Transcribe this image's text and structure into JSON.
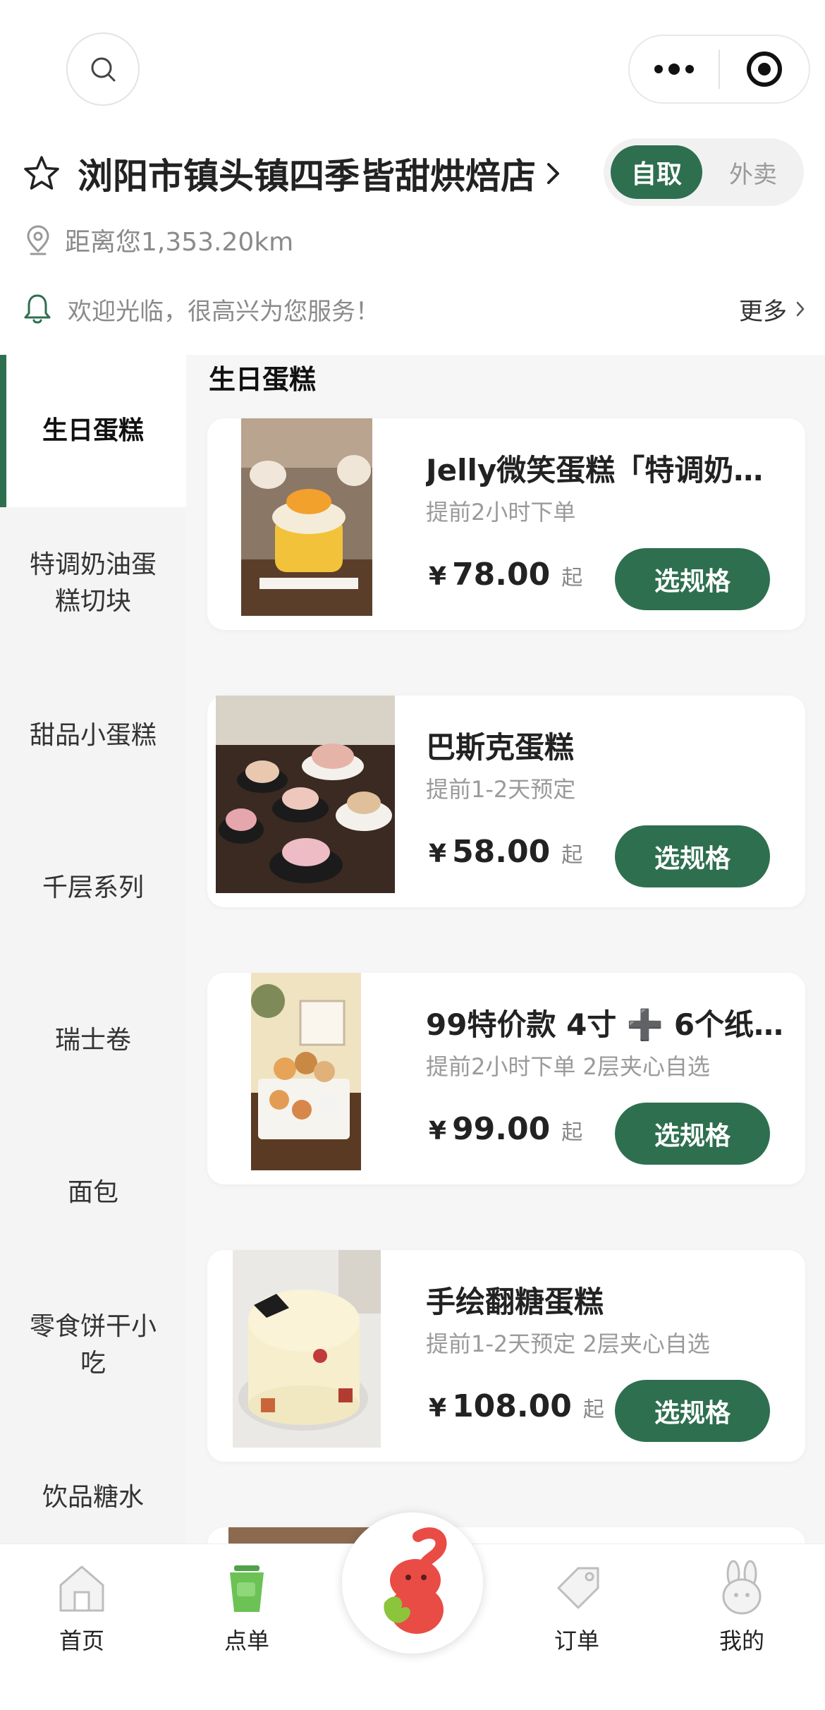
{
  "header": {
    "store_name": "浏阳市镇头镇四季皆甜烘焙店",
    "mode_active": "自取",
    "mode_inactive": "外卖",
    "distance": "距离您1,353.20km",
    "notice": "欢迎光临，很高兴为您服务！",
    "more": "更多"
  },
  "colors": {
    "accent": "#2e6f4f",
    "background": "#f6f6f6"
  },
  "sidebar": {
    "items": [
      {
        "label": "生日蛋糕",
        "active": true
      },
      {
        "label": "特调奶油蛋糕切块"
      },
      {
        "label": "甜品小蛋糕"
      },
      {
        "label": "千层系列"
      },
      {
        "label": "瑞士卷"
      },
      {
        "label": "面包"
      },
      {
        "label": "零食饼干小吃"
      },
      {
        "label": "饮品糖水"
      }
    ]
  },
  "section": {
    "title": "生日蛋糕"
  },
  "products": [
    {
      "name": "Jelly微笑蛋糕「特调奶…",
      "note": "提前2小时下单",
      "currency": "¥",
      "price": "78.00",
      "suffix": "起",
      "button": "选规格"
    },
    {
      "name": "巴斯克蛋糕",
      "note": "提前1-2天预定",
      "currency": "¥",
      "price": "58.00",
      "suffix": "起",
      "button": "选规格"
    },
    {
      "name": "99特价款 4寸 ➕ 6个纸…",
      "note": "提前2小时下单 2层夹心自选",
      "currency": "¥",
      "price": "99.00",
      "suffix": "起",
      "button": "选规格"
    },
    {
      "name": "手绘翻糖蛋糕",
      "note": "提前1-2天预定 2层夹心自选",
      "currency": "¥",
      "price": "108.00",
      "suffix": "起",
      "button": "选规格"
    }
  ],
  "tabbar": {
    "home": "首页",
    "order": "点单",
    "orders": "订单",
    "mine": "我的"
  },
  "icons": [
    "search-icon",
    "more-dots-icon",
    "target-icon",
    "star-icon",
    "chevron-right-icon",
    "location-pin-icon",
    "bell-icon",
    "home-icon",
    "cup-icon",
    "tag-icon",
    "rabbit-icon",
    "mascot-icon"
  ]
}
